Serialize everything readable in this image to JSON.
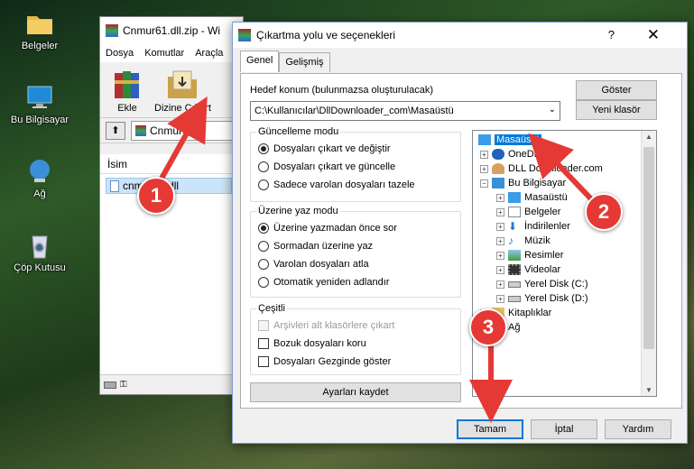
{
  "desktop": {
    "icons": [
      {
        "label": "Belgeler"
      },
      {
        "label": "Bu Bilgisayar"
      },
      {
        "label": "Ağ"
      },
      {
        "label": "Çöp Kutusu"
      }
    ]
  },
  "winrar": {
    "title": "Cnmur61.dll.zip - Wi",
    "menu": [
      "Dosya",
      "Komutlar",
      "Araçla"
    ],
    "tools": {
      "add": "Ekle",
      "extract": "Dizine Çıkart"
    },
    "address": "Cnmur61.dl",
    "list_header": "İsim",
    "file": "cnmur61.dll"
  },
  "dialog": {
    "title": "Çıkartma yolu ve seçenekleri",
    "help": "?",
    "close": "✕",
    "tabs": [
      "Genel",
      "Gelişmiş"
    ],
    "dest_label": "Hedef konum (bulunmazsa oluşturulacak)",
    "dest_value": "C:\\Kullanıcılar\\DllDownloader_com\\Masaüstü",
    "show_btn": "Göster",
    "new_folder_btn": "Yeni klasör",
    "update_mode": {
      "title": "Güncelleme modu",
      "options": [
        "Dosyaları çıkart ve değiştir",
        "Dosyaları çıkart ve güncelle",
        "Sadece varolan dosyaları tazele"
      ],
      "selected": 0
    },
    "overwrite_mode": {
      "title": "Üzerine yaz modu",
      "options": [
        "Üzerine yazmadan önce sor",
        "Sormadan üzerine yaz",
        "Varolan dosyaları atla",
        "Otomatik yeniden adlandır"
      ],
      "selected": 0
    },
    "misc": {
      "title": "Çeşitli",
      "options": [
        "Arşivleri alt klasörlere çıkart",
        "Bozuk dosyaları koru",
        "Dosyaları Gezginde göster"
      ]
    },
    "save_btn": "Ayarları kaydet",
    "tree": [
      {
        "label": "Masaüstü",
        "selected": true
      },
      {
        "label": "OneDrive"
      },
      {
        "label": "DLL Downloader.com"
      },
      {
        "label": "Bu Bilgisayar"
      },
      {
        "label": "Masaüstü"
      },
      {
        "label": "Belgeler"
      },
      {
        "label": "İndirilenler"
      },
      {
        "label": "Müzik"
      },
      {
        "label": "Resimler"
      },
      {
        "label": "Videolar"
      },
      {
        "label": "Yerel Disk (C:)"
      },
      {
        "label": "Yerel Disk (D:)"
      },
      {
        "label": "Kitaplıklar"
      },
      {
        "label": "Ağ"
      }
    ],
    "buttons": {
      "ok": "Tamam",
      "cancel": "İptal",
      "help": "Yardım"
    }
  },
  "annotations": {
    "steps": [
      "1",
      "2",
      "3"
    ],
    "color": "#e53935"
  }
}
